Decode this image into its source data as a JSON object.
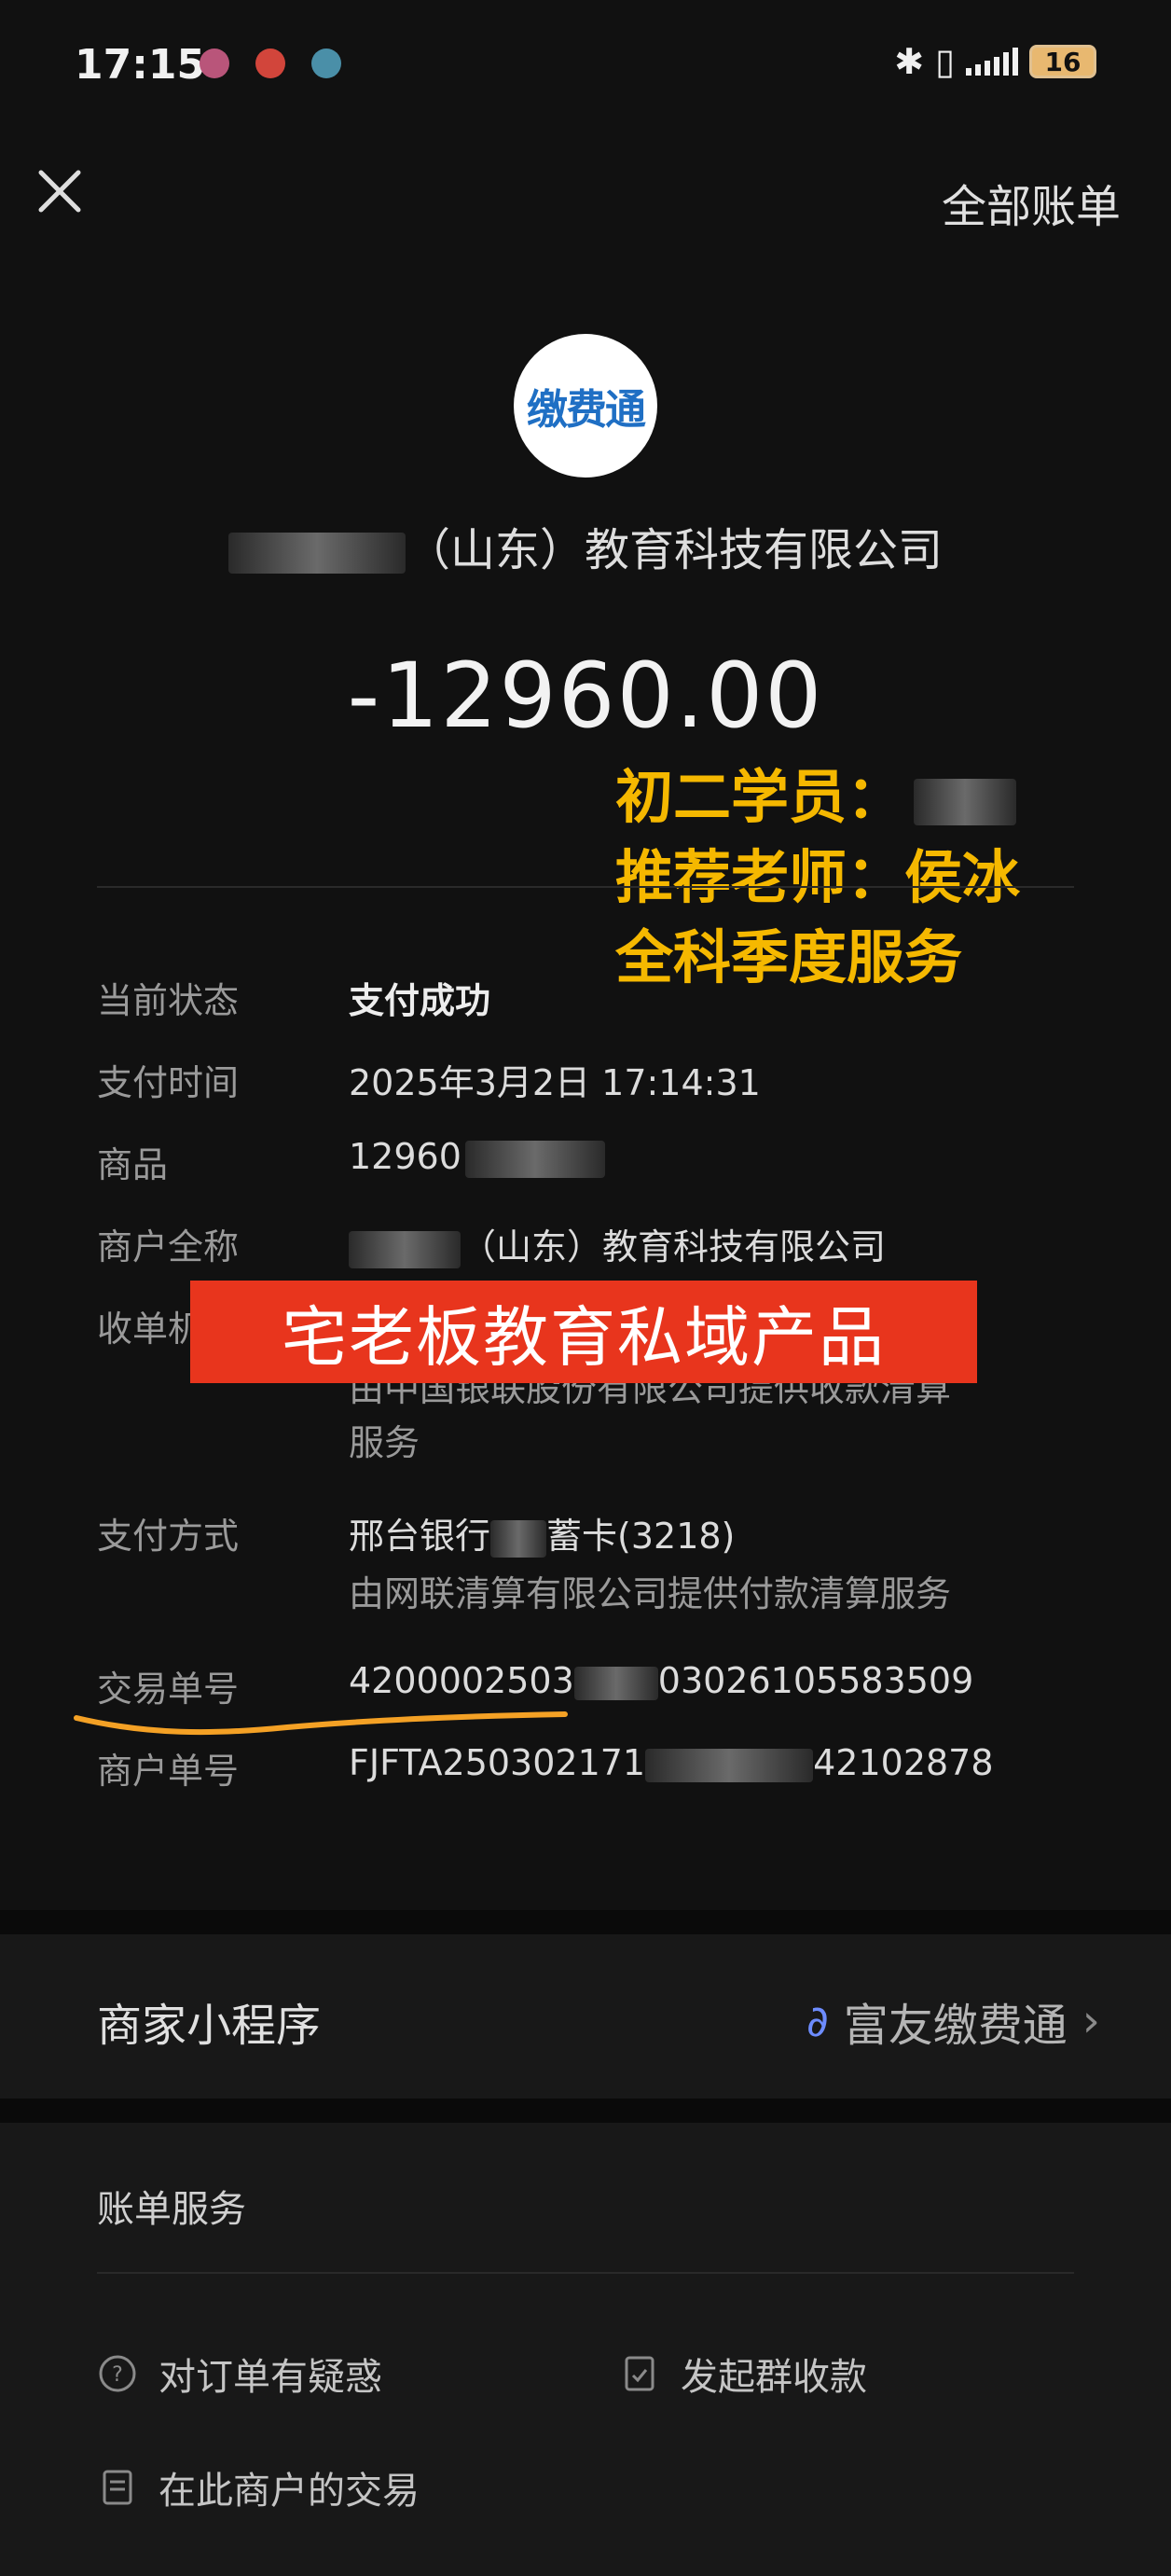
{
  "status_bar": {
    "time": "17:15",
    "battery": "16"
  },
  "nav": {
    "all_bills": "全部账单"
  },
  "merchant": {
    "logo_text": "缴费通",
    "name_suffix": "（山东）教育科技有限公司"
  },
  "amount": "-12960.00",
  "overlay": {
    "line1": "初二学员：",
    "line2": "推荐老师：侯冰",
    "line3": "全科季度服务"
  },
  "details": {
    "status_label": "当前状态",
    "status_value": "支付成功",
    "time_label": "支付时间",
    "time_value": "2025年3月2日 17:14:31",
    "goods_label": "商品",
    "goods_value": "12960",
    "merchant_full_label": "商户全称",
    "merchant_full_value": "（山东）教育科技有限公司",
    "acquirer_label": "收单机构",
    "acquirer_sub1": "由中国银联股份有限公司提供收款清算",
    "acquirer_sub2": "服务",
    "pay_method_label": "支付方式",
    "pay_method_value_a": "邢台银行",
    "pay_method_value_b": "蓄卡(3218)",
    "pay_method_sub": "由网联清算有限公司提供付款清算服务",
    "txn_label": "交易单号",
    "txn_value_a": "4200002503",
    "txn_value_b": "03026105583509",
    "merchant_no_label": "商户单号",
    "merchant_no_value_a": "FJFTA250302171",
    "merchant_no_value_b": "42102878"
  },
  "banner": "宅老板教育私域产品",
  "mini_program": {
    "label": "商家小程序",
    "link": "富友缴费通"
  },
  "bill_services": {
    "title": "账单服务",
    "question": "对订单有疑惑",
    "group_pay": "发起群收款",
    "merchant_txn": "在此商户的交易"
  }
}
